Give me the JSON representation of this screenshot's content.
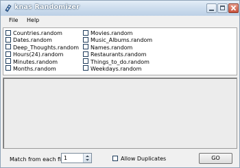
{
  "window": {
    "title": "knas Randomizer"
  },
  "menu": {
    "file": "File",
    "help": "Help"
  },
  "files": {
    "left": [
      "Countries.random",
      "Dates.random",
      "Deep_Thoughts.random",
      "Hours(24).random",
      "Minutes.random",
      "Months.random"
    ],
    "right": [
      "Movies.random",
      "Music_Albums.random",
      "Names.random",
      "Restaurants.random",
      "Things_to_do.random",
      "Weekdays.random"
    ]
  },
  "controls": {
    "match_label": "Match  from each file",
    "match_value": "1",
    "allow_duplicates_label": "Allow Duplicates",
    "go_label": "GO"
  },
  "icons": {
    "app": "dice-icon",
    "minimize": "minimize-icon",
    "maximize": "maximize-icon",
    "close": "close-icon",
    "spinner": "spinner-icon"
  }
}
